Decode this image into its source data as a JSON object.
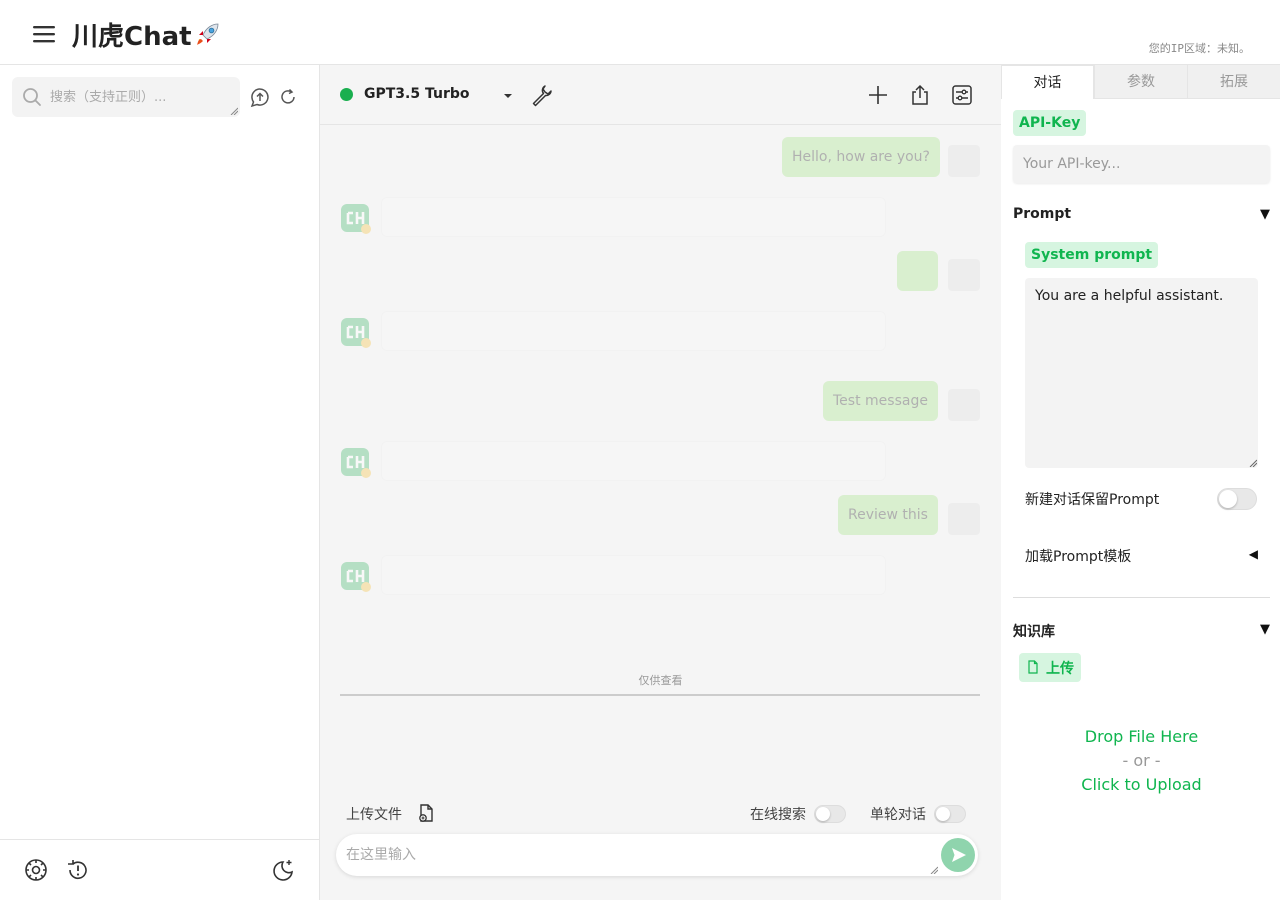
{
  "colors": {
    "accent": "#10b54f",
    "chip_bg": "#d6f5e0",
    "user_bubble": "#a6e58a",
    "status": "#1aaf4f",
    "send": "#5cc38a"
  },
  "header": {
    "title": "川虎Chat",
    "ip_info": "您的IP区域：未知。"
  },
  "sidebar": {
    "search_placeholder": "搜索（支持正则）..."
  },
  "chat": {
    "model": "GPT3.5 Turbo",
    "messages": [
      {
        "role": "user",
        "text": "Hello, how are you?"
      },
      {
        "role": "assistant",
        "text": ""
      },
      {
        "role": "user",
        "text": ""
      },
      {
        "role": "assistant",
        "text": ""
      },
      {
        "role": "user",
        "text": "Test message"
      },
      {
        "role": "assistant",
        "text": ""
      },
      {
        "role": "user",
        "text": "Review this"
      },
      {
        "role": "assistant",
        "text": ""
      }
    ],
    "readonly_label": "仅供查看",
    "upload_label": "上传文件",
    "online_search_label": "在线搜索",
    "single_turn_label": "单轮对话",
    "input_placeholder": "在这里输入"
  },
  "right_panel": {
    "tabs": [
      {
        "label": "对话",
        "active": true
      },
      {
        "label": "参数",
        "active": false
      },
      {
        "label": "拓展",
        "active": false
      }
    ],
    "api_key_label": "API-Key",
    "api_key_placeholder": "Your API-key...",
    "prompt_section": "Prompt",
    "system_prompt_label": "System prompt",
    "system_prompt_value": "You are a helpful assistant.",
    "keep_prompt_label": "新建对话保留Prompt",
    "load_template_label": "加载Prompt模板",
    "knowledge_section": "知识库",
    "upload_button": "上传",
    "drop_text": "Drop File Here",
    "or_text": "- or -",
    "click_text": "Click to Upload",
    "caret_down": "▼",
    "caret_left": "◀"
  }
}
